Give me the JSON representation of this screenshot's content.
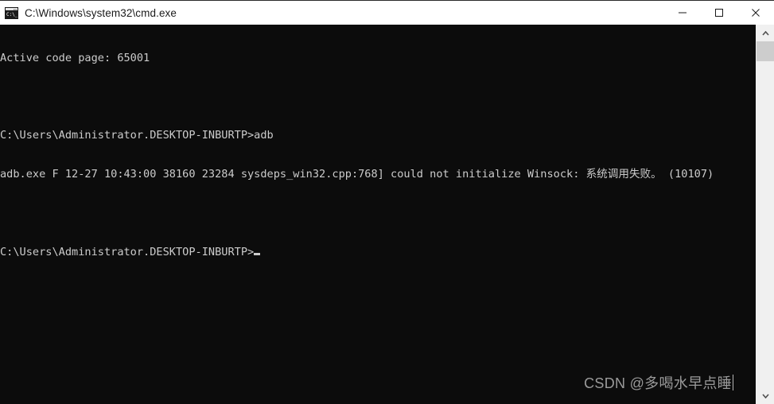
{
  "window": {
    "title": "C:\\Windows\\system32\\cmd.exe",
    "icon_name": "cmd-icon",
    "icon_glyph": "C:\\_",
    "background_color": "#0c0c0c",
    "titlebar_color": "#ffffff",
    "text_color": "#cccccc"
  },
  "controls": {
    "minimize_label": "Minimize",
    "maximize_label": "Maximize",
    "close_label": "Close"
  },
  "console": {
    "lines": [
      "Active code page: 65001",
      "",
      "C:\\Users\\Administrator.DESKTOP-INBURTP>adb",
      "adb.exe F 12-27 10:43:00 38160 23284 sysdeps_win32.cpp:768] could not initialize Winsock: 系统调用失败。 (10107)",
      "",
      "C:\\Users\\Administrator.DESKTOP-INBURTP>"
    ],
    "code_page": "65001",
    "prompt": "C:\\Users\\Administrator.DESKTOP-INBURTP>",
    "command": "adb",
    "error": {
      "process": "adb.exe",
      "level": "F",
      "date": "12-27",
      "time": "10:43:00",
      "pid": "38160",
      "tid": "23284",
      "source": "sysdeps_win32.cpp:768]",
      "message": "could not initialize Winsock: 系统调用失败。",
      "code": "(10107)"
    }
  },
  "watermark": {
    "text": "CSDN @多喝水早点睡"
  },
  "scrollbar": {
    "up_arrow": "⌃",
    "down_arrow": "⌄"
  }
}
